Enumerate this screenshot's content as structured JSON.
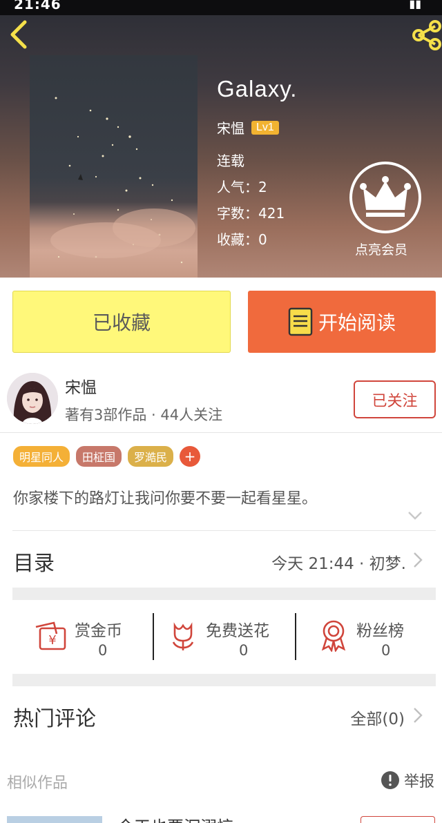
{
  "status_bar": {
    "time": "21:46"
  },
  "header": {
    "book_title": "Galaxy.",
    "author_name": "宋愠",
    "author_level": "Lv1",
    "status": "连载",
    "popularity": "人气：2",
    "word_count": "字数：421",
    "favorites": "收藏：0",
    "vip_label": "点亮会员"
  },
  "actions": {
    "collected_label": "已收藏",
    "read_label": "开始阅读"
  },
  "author_profile": {
    "name": "宋愠",
    "subtitle": "著有3部作品 · 44人关注",
    "follow_label": "已关注"
  },
  "tags": [
    {
      "label": "明星同人",
      "color": "#f4b037"
    },
    {
      "label": "田柾国",
      "color": "#c7786a"
    },
    {
      "label": "罗澔民",
      "color": "#dbb04a"
    }
  ],
  "summary": "你家楼下的路灯让我问你要不要一起看星星。",
  "catalog": {
    "title": "目录",
    "latest": "今天 21:44 · 初梦."
  },
  "stats": [
    {
      "label": "赏金币",
      "value": "0",
      "icon": "red-packet-icon"
    },
    {
      "label": "免费送花",
      "value": "0",
      "icon": "flower-icon"
    },
    {
      "label": "粉丝榜",
      "value": "0",
      "icon": "medal-icon"
    }
  ],
  "comments": {
    "title": "热门评论",
    "all_label": "全部(0)"
  },
  "similar": {
    "title": "相似作品",
    "report_label": "举报",
    "first_item_partial": "今天也要沉溺惊"
  },
  "colors": {
    "accent_red": "#d0453b",
    "read_orange": "#f06a3d",
    "collected_yellow": "#fff87a",
    "level_gold": "#f2b331"
  }
}
